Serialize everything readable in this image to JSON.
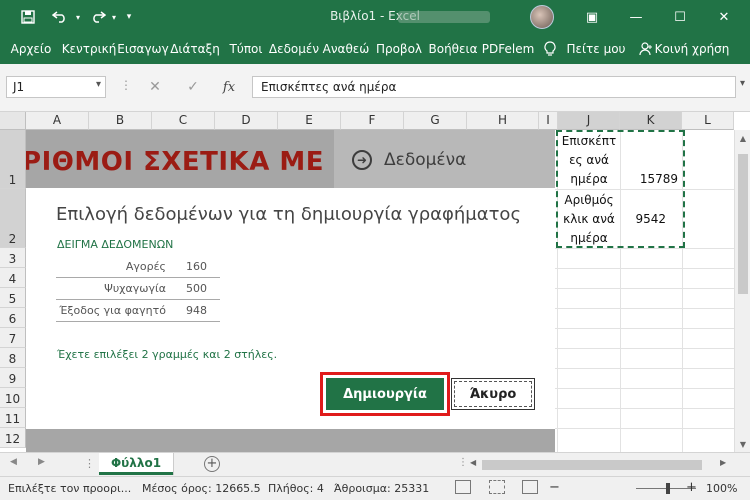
{
  "app": {
    "title": "Βιβλίο1  -  Excel",
    "quick_access": {
      "save_icon": "floppy-icon",
      "undo_icon": "undo-icon",
      "redo_icon": "redo-icon",
      "customize_icon": "customize-icon"
    },
    "window_buttons": {
      "ribbon_display": "▣",
      "minimize": "—",
      "restore": "☐",
      "close": "✕"
    }
  },
  "ribbon": {
    "tabs": [
      "Αρχείο",
      "Κεντρική",
      "Εισαγωγ",
      "Διάταξη",
      "Τύποι",
      "Δεδομέν",
      "Αναθεώ",
      "Προβολ",
      "Βοήθεια",
      "PDFelem"
    ],
    "tell_me": "Πείτε μου",
    "share": "Κοινή χρήση"
  },
  "formula_bar": {
    "name_box": "J1",
    "formula": "Επισκέπτες ανά ημέρα",
    "cancel_icon": "✕",
    "enter_icon": "✓",
    "fx_label": "fx"
  },
  "grid": {
    "columns": [
      "A",
      "B",
      "C",
      "D",
      "E",
      "F",
      "G",
      "H",
      "I",
      "J",
      "K",
      "L"
    ],
    "rows": [
      "1",
      "2",
      "3",
      "4",
      "5",
      "6",
      "7",
      "8",
      "9",
      "10",
      "11",
      "12"
    ],
    "cells": {
      "J1": [
        "Επισκέπτ",
        "ες ανά",
        "ημέρα"
      ],
      "K1": "15789",
      "J2": [
        "Αριθμός",
        "κλικ ανά",
        "ημέρα"
      ],
      "K2": "9542"
    }
  },
  "dialog": {
    "banner_text": "ΡΙΘΜΟΙ ΣΧΕΤΙΚΑ ΜΕ",
    "banner_label": "Δεδομένα",
    "title": "Επιλογή δεδομένων για τη δημιουργία γραφήματος",
    "sample_header": "ΔΕΙΓΜΑ ΔΕΔΟΜΕΝΩΝ",
    "sample_rows": [
      {
        "name": "Αγορές",
        "value": "160"
      },
      {
        "name": "Ψυχαγωγία",
        "value": "500"
      },
      {
        "name": "Έξοδος για φαγητό",
        "value": "948"
      }
    ],
    "selection_info": "Έχετε επιλέξει 2 γραμμές και 2 στήλες.",
    "create_button": "Δημιουργία",
    "cancel_button": "Άκυρο"
  },
  "sheet_tabs": {
    "active": "Φύλλο1",
    "add": "+"
  },
  "status_bar": {
    "left": "Επιλέξτε τον προορι...",
    "average": "Μέσος όρος: 12665.5",
    "count": "Πλήθος: 4",
    "sum": "Άθροισμα: 25331",
    "zoom_minus": "−",
    "zoom_plus": "+",
    "zoom": "100%"
  },
  "colors": {
    "excel_green": "#217346",
    "banner_red": "#9b1c14",
    "highlight_red": "#e01b1b"
  }
}
